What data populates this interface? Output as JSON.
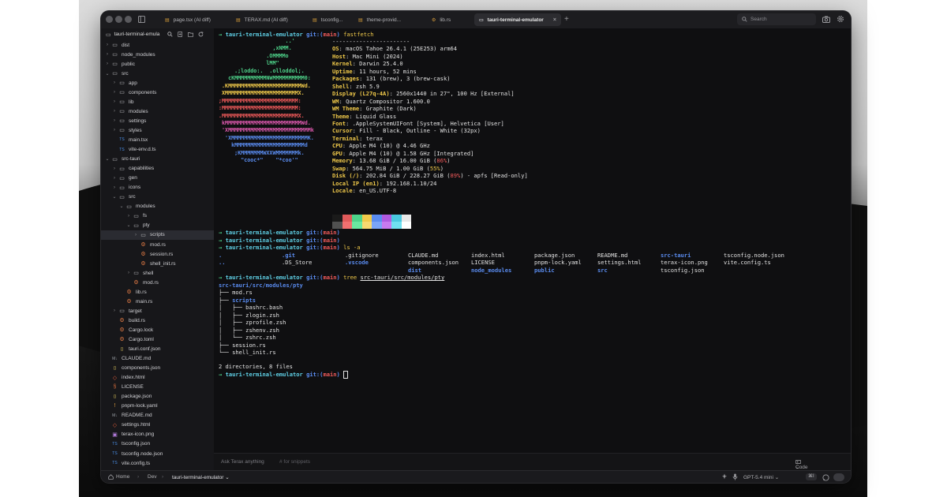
{
  "tabs": [
    {
      "label": "page.tsx (AI diff)",
      "icon": "file-icon",
      "active": false
    },
    {
      "label": "TERAX.md (AI diff)",
      "icon": "file-icon",
      "active": false
    },
    {
      "label": "tsconfig...",
      "icon": "file-icon",
      "active": false
    },
    {
      "label": "theme-provid...",
      "icon": "file-icon",
      "active": false
    },
    {
      "label": "lib.rs",
      "icon": "rust-icon",
      "active": false
    },
    {
      "label": "tauri-terminal-emulator",
      "icon": "terminal-icon",
      "active": true
    }
  ],
  "search": {
    "placeholder": "Search"
  },
  "sidebar": {
    "title": "tauri-terminal-emula",
    "tree": [
      {
        "label": "dist",
        "depth": 0,
        "type": "folder",
        "expanded": false
      },
      {
        "label": "node_modules",
        "depth": 0,
        "type": "folder",
        "expanded": false
      },
      {
        "label": "public",
        "depth": 0,
        "type": "folder",
        "expanded": false
      },
      {
        "label": "src",
        "depth": 0,
        "type": "folder",
        "expanded": true
      },
      {
        "label": "app",
        "depth": 1,
        "type": "folder",
        "expanded": false
      },
      {
        "label": "components",
        "depth": 1,
        "type": "folder",
        "expanded": false
      },
      {
        "label": "lib",
        "depth": 1,
        "type": "folder",
        "expanded": false
      },
      {
        "label": "modules",
        "depth": 1,
        "type": "folder",
        "expanded": false
      },
      {
        "label": "settings",
        "depth": 1,
        "type": "folder",
        "expanded": false
      },
      {
        "label": "styles",
        "depth": 1,
        "type": "folder",
        "expanded": false
      },
      {
        "label": "main.tsx",
        "depth": 1,
        "type": "ts"
      },
      {
        "label": "vite-env.d.ts",
        "depth": 1,
        "type": "ts"
      },
      {
        "label": "src-tauri",
        "depth": 0,
        "type": "folder",
        "expanded": true
      },
      {
        "label": "capabilities",
        "depth": 1,
        "type": "folder",
        "expanded": false
      },
      {
        "label": "gen",
        "depth": 1,
        "type": "folder",
        "expanded": false
      },
      {
        "label": "icons",
        "depth": 1,
        "type": "folder",
        "expanded": false
      },
      {
        "label": "src",
        "depth": 1,
        "type": "folder",
        "expanded": true
      },
      {
        "label": "modules",
        "depth": 2,
        "type": "folder",
        "expanded": true
      },
      {
        "label": "fs",
        "depth": 3,
        "type": "folder",
        "expanded": false
      },
      {
        "label": "pty",
        "depth": 3,
        "type": "folder",
        "expanded": true
      },
      {
        "label": "scripts",
        "depth": 4,
        "type": "folder",
        "expanded": false,
        "selected": true
      },
      {
        "label": "mod.rs",
        "depth": 4,
        "type": "rs"
      },
      {
        "label": "session.rs",
        "depth": 4,
        "type": "rs"
      },
      {
        "label": "shell_init.rs",
        "depth": 4,
        "type": "rs"
      },
      {
        "label": "shell",
        "depth": 3,
        "type": "folder",
        "expanded": false
      },
      {
        "label": "mod.rs",
        "depth": 3,
        "type": "rs"
      },
      {
        "label": "lib.rs",
        "depth": 2,
        "type": "rs"
      },
      {
        "label": "main.rs",
        "depth": 2,
        "type": "rs"
      },
      {
        "label": "target",
        "depth": 1,
        "type": "folder",
        "expanded": false
      },
      {
        "label": "build.rs",
        "depth": 1,
        "type": "rs"
      },
      {
        "label": "Cargo.lock",
        "depth": 1,
        "type": "rs"
      },
      {
        "label": "Cargo.toml",
        "depth": 1,
        "type": "rs"
      },
      {
        "label": "tauri.conf.json",
        "depth": 1,
        "type": "json"
      },
      {
        "label": "CLAUDE.md",
        "depth": 0,
        "type": "md"
      },
      {
        "label": "components.json",
        "depth": 0,
        "type": "json"
      },
      {
        "label": "index.html",
        "depth": 0,
        "type": "html"
      },
      {
        "label": "LICENSE",
        "depth": 0,
        "type": "lic"
      },
      {
        "label": "package.json",
        "depth": 0,
        "type": "json"
      },
      {
        "label": "pnpm-lock.yaml",
        "depth": 0,
        "type": "yaml"
      },
      {
        "label": "README.md",
        "depth": 0,
        "type": "md"
      },
      {
        "label": "settings.html",
        "depth": 0,
        "type": "html"
      },
      {
        "label": "terax-icon.png",
        "depth": 0,
        "type": "png"
      },
      {
        "label": "tsconfig.json",
        "depth": 0,
        "type": "ts"
      },
      {
        "label": "tsconfig.node.json",
        "depth": 0,
        "type": "ts"
      },
      {
        "label": "vite.config.ts",
        "depth": 0,
        "type": "ts"
      }
    ]
  },
  "terminal": {
    "prompt": {
      "arrow": "→",
      "dir": "tauri-terminal-emulator",
      "git": "git:",
      "branch_open": "(",
      "branch": "main",
      "branch_close": ")"
    },
    "cmd_fastfetch": "fastfetch",
    "ascii": [
      "                     ..'",
      "                 ,xNMM.",
      "               .OMMMMo",
      "               lMM\"",
      "     .;loddo:.  .olloddol;.",
      "   cKMMMMMMMMMMNWMMMMMMMMMM0:",
      " .KMMMMMMMMMMMMMMMMMMMMMMMWd.",
      " XMMMMMMMMMMMMMMMMMMMMMMMX.",
      ";MMMMMMMMMMMMMMMMMMMMMMMM:",
      ":MMMMMMMMMMMMMMMMMMMMMMMM:",
      ".MMMMMMMMMMMMMMMMMMMMMMMMX.",
      " kMMMMMMMMMMMMMMMMMMMMMMMMWd.",
      " 'XMMMMMMMMMMMMMMMMMMMMMMMMMMk",
      "  'XMMMMMMMMMMMMMMMMMMMMMMMMK.",
      "    kMMMMMMMMMMMMMMMMMMMMMMd",
      "     ;KMMMMMMMWXXWMMMMMMMk.",
      "       \"cooc*\"    \"*coo'\""
    ],
    "info": [
      {
        "key": "",
        "value": "-----------------------"
      },
      {
        "key": "OS",
        "value": "macOS Tahoe 26.4.1 (25E253) arm64"
      },
      {
        "key": "Host",
        "value": "Mac Mini (2024)"
      },
      {
        "key": "Kernel",
        "value": "Darwin 25.4.0"
      },
      {
        "key": "Uptime",
        "value": "11 hours, 52 mins"
      },
      {
        "key": "Packages",
        "value": "131 (brew), 3 (brew-cask)"
      },
      {
        "key": "Shell",
        "value": "zsh 5.9"
      },
      {
        "key": "Display (L27q-4A)",
        "value": "2560x1440 in 27\", 100 Hz [External]"
      },
      {
        "key": "WM",
        "value": "Quartz Compositor 1.600.0"
      },
      {
        "key": "WM Theme",
        "value": "Graphite (Dark)"
      },
      {
        "key": "Theme",
        "value": "Liquid Glass"
      },
      {
        "key": "Font",
        "value": ".AppleSystemUIFont [System], Helvetica [User]"
      },
      {
        "key": "Cursor",
        "value": "Fill - Black, Outline - White (32px)"
      },
      {
        "key": "Terminal",
        "value": "terax"
      },
      {
        "key": "CPU",
        "value": "Apple M4 (10) @ 4.46 GHz"
      },
      {
        "key": "GPU",
        "value": "Apple M4 (10) @ 1.58 GHz [Integrated]"
      },
      {
        "key": "Memory",
        "value": "13.68 GiB / 16.00 GiB",
        "pct": "86%"
      },
      {
        "key": "Swap",
        "value": "564.75 MiB / 1.00 GiB",
        "pct": "55%"
      },
      {
        "key": "Disk (/)",
        "value": "202.84 GiB / 228.27 GiB",
        "pct": "89%",
        "suffix": " - apfs [Read-only]"
      },
      {
        "key": "Local IP (en1)",
        "value": "192.168.1.10/24"
      },
      {
        "key": "Locale",
        "value": "en_US.UTF-8"
      }
    ],
    "swatches_top": [
      "#1a1a1a",
      "#e05a5a",
      "#4ed38a",
      "#f0c94a",
      "#5a8cf0",
      "#b05ae0",
      "#4ac8e0",
      "#e8e8e8"
    ],
    "swatches_bottom": [
      "#505050",
      "#f07070",
      "#6ae8a0",
      "#f8d870",
      "#7aa4f8",
      "#c87af0",
      "#70e0f0",
      "#ffffff"
    ],
    "cmd_ls": "ls -a",
    "ls_columns": [
      [
        ".",
        ".."
      ],
      [
        ".git",
        ".DS_Store"
      ],
      [
        ".gitignore",
        ".vscode"
      ],
      [
        "CLAUDE.md",
        "components.json",
        "dist"
      ],
      [
        "index.html",
        "LICENSE",
        "node_modules"
      ],
      [
        "package.json",
        "pnpm-lock.yaml",
        "public"
      ],
      [
        "README.md",
        "settings.html",
        "src"
      ],
      [
        "src-tauri",
        "terax-icon.png",
        "tsconfig.json"
      ],
      [
        "tsconfig.node.json",
        "vite.config.ts"
      ]
    ],
    "cmd_tree": "tree",
    "tree_arg": "src-tauri/src/modules/pty",
    "tree_root": "src-tauri/src/modules/pty",
    "tree_lines": [
      {
        "prefix": "├── ",
        "name": "mod.rs",
        "dir": false
      },
      {
        "prefix": "├── ",
        "name": "scripts",
        "dir": true
      },
      {
        "prefix": "│   ├── ",
        "name": "bashrc.bash",
        "dir": false
      },
      {
        "prefix": "│   ├── ",
        "name": "zlogin.zsh",
        "dir": false
      },
      {
        "prefix": "│   ├── ",
        "name": "zprofile.zsh",
        "dir": false
      },
      {
        "prefix": "│   ├── ",
        "name": "zshenv.zsh",
        "dir": false
      },
      {
        "prefix": "│   └── ",
        "name": "zshrc.zsh",
        "dir": false
      },
      {
        "prefix": "├── ",
        "name": "session.rs",
        "dir": false
      },
      {
        "prefix": "└── ",
        "name": "shell_init.rs",
        "dir": false
      }
    ],
    "summary": "2 directories, 8 files"
  },
  "askbar": {
    "placeholder": "Ask Terax anything",
    "hint": "# for snippets",
    "mode": "Code Reviewer"
  },
  "statusbar": {
    "home": "Home",
    "crumb_dev": "Dev",
    "crumb_project": "tauri-terminal-emulator",
    "model": "GPT-5.4 mini",
    "shortcut": "⌘I"
  }
}
